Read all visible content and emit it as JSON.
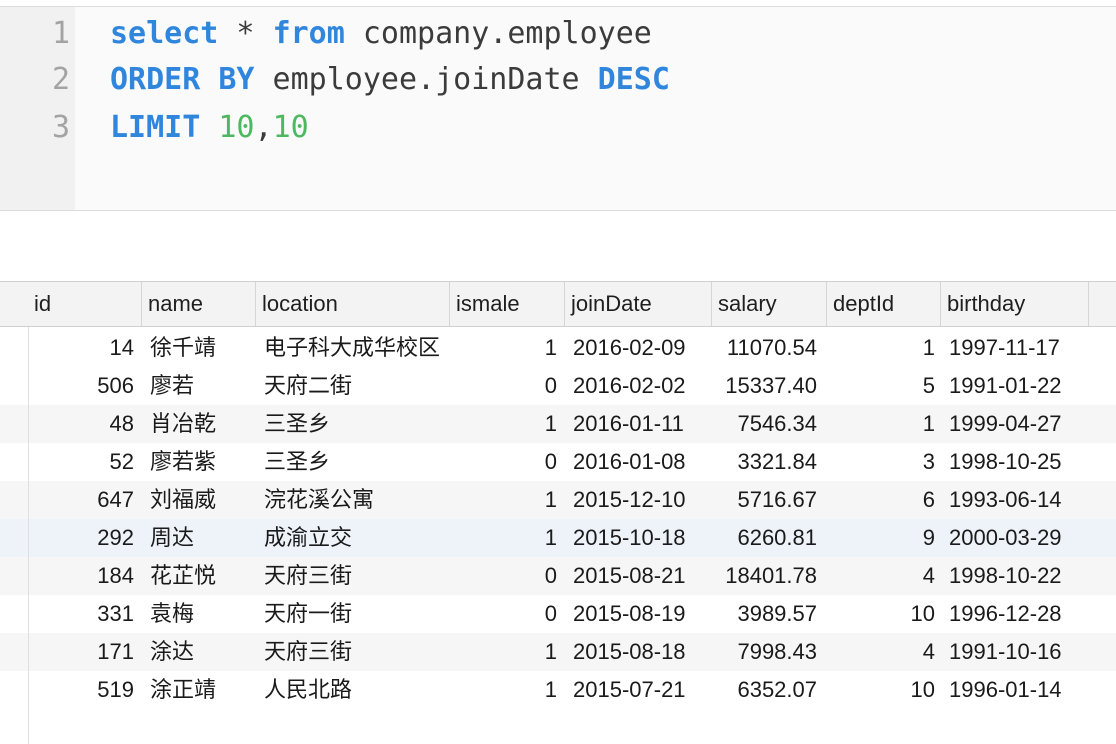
{
  "editor": {
    "lines": [
      {
        "num": "1",
        "tokens": [
          {
            "t": "select",
            "k": "kw"
          },
          {
            "t": " * ",
            "k": "plain"
          },
          {
            "t": "from",
            "k": "kw"
          },
          {
            "t": " company.employee",
            "k": "plain"
          }
        ]
      },
      {
        "num": "2",
        "tokens": [
          {
            "t": "ORDER BY",
            "k": "kw"
          },
          {
            "t": " employee.joinDate ",
            "k": "plain"
          },
          {
            "t": "DESC",
            "k": "kw"
          }
        ]
      },
      {
        "num": "3",
        "tokens": [
          {
            "t": "LIMIT",
            "k": "kw"
          },
          {
            "t": " ",
            "k": "plain"
          },
          {
            "t": "10",
            "k": "num"
          },
          {
            "t": ",",
            "k": "plain"
          },
          {
            "t": "10",
            "k": "num"
          }
        ]
      }
    ]
  },
  "results": {
    "columns": [
      "id",
      "name",
      "location",
      "ismale",
      "joinDate",
      "salary",
      "deptId",
      "birthday"
    ],
    "rows": [
      [
        "14",
        "徐千靖",
        "电子科大成华校区",
        "1",
        "2016-02-09",
        "11070.54",
        "1",
        "1997-11-17"
      ],
      [
        "506",
        "廖若",
        "天府二街",
        "0",
        "2016-02-02",
        "15337.40",
        "5",
        "1991-01-22"
      ],
      [
        "48",
        "肖冶乾",
        "三圣乡",
        "1",
        "2016-01-11",
        "7546.34",
        "1",
        "1999-04-27"
      ],
      [
        "52",
        "廖若紫",
        "三圣乡",
        "0",
        "2016-01-08",
        "3321.84",
        "3",
        "1998-10-25"
      ],
      [
        "647",
        "刘福威",
        "浣花溪公寓",
        "1",
        "2015-12-10",
        "5716.67",
        "6",
        "1993-06-14"
      ],
      [
        "292",
        "周达",
        "成渝立交",
        "1",
        "2015-10-18",
        "6260.81",
        "9",
        "2000-03-29"
      ],
      [
        "184",
        "花芷悦",
        "天府三街",
        "0",
        "2015-08-21",
        "18401.78",
        "4",
        "1998-10-22"
      ],
      [
        "331",
        "袁梅",
        "天府一街",
        "0",
        "2015-08-19",
        "3989.57",
        "10",
        "1996-12-28"
      ],
      [
        "171",
        "涂达",
        "天府三街",
        "1",
        "2015-08-18",
        "7998.43",
        "4",
        "1991-10-16"
      ],
      [
        "519",
        "涂正靖",
        "人民北路",
        "1",
        "2015-07-21",
        "6352.07",
        "10",
        "1996-01-14"
      ]
    ],
    "selected_row": 5
  }
}
